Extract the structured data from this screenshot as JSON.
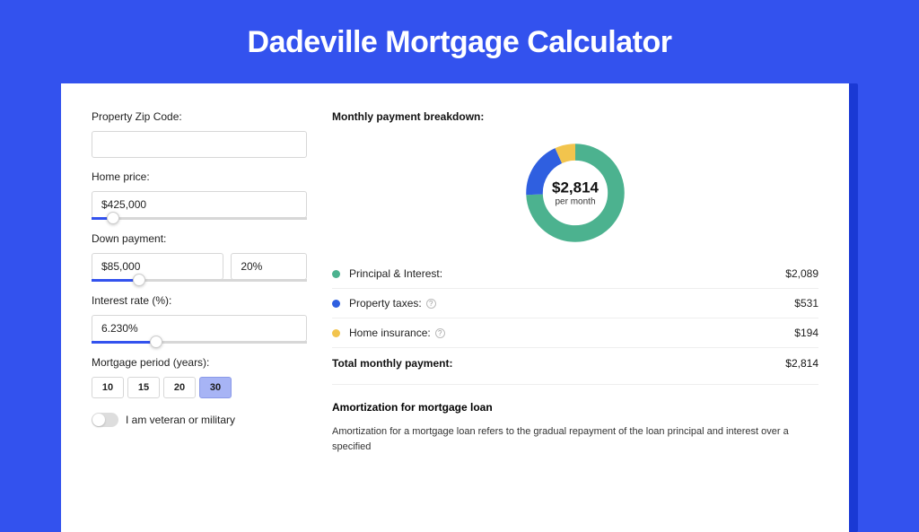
{
  "title": "Dadeville Mortgage Calculator",
  "form": {
    "zip": {
      "label": "Property Zip Code:",
      "value": ""
    },
    "home_price": {
      "label": "Home price:",
      "value": "$425,000",
      "slider_fill_pct": 10,
      "thumb_pct": 10
    },
    "down_payment": {
      "label": "Down payment:",
      "value": "$85,000",
      "pct_value": "20%",
      "slider_fill_pct": 22,
      "thumb_pct": 22
    },
    "interest": {
      "label": "Interest rate (%):",
      "value": "6.230%",
      "slider_fill_pct": 30,
      "thumb_pct": 30
    },
    "period": {
      "label": "Mortgage period (years):",
      "options": [
        "10",
        "15",
        "20",
        "30"
      ],
      "selected": "30"
    },
    "veteran": {
      "label": "I am veteran or military",
      "on": false
    }
  },
  "breakdown": {
    "title": "Monthly payment breakdown:",
    "center_value": "$2,814",
    "center_sub": "per month",
    "items": [
      {
        "key": "principal",
        "label": "Principal & Interest:",
        "value": "$2,089",
        "color": "#4cb28f",
        "has_info": false,
        "fraction": 0.742
      },
      {
        "key": "taxes",
        "label": "Property taxes:",
        "value": "$531",
        "color": "#2f5fe0",
        "has_info": true,
        "fraction": 0.189
      },
      {
        "key": "insurance",
        "label": "Home insurance:",
        "value": "$194",
        "color": "#f2c44d",
        "has_info": true,
        "fraction": 0.069
      }
    ],
    "total_label": "Total monthly payment:",
    "total_value": "$2,814"
  },
  "amortization": {
    "title": "Amortization for mortgage loan",
    "text": "Amortization for a mortgage loan refers to the gradual repayment of the loan principal and interest over a specified"
  },
  "chart_data": {
    "type": "pie",
    "title": "Monthly payment breakdown",
    "series": [
      {
        "name": "Principal & Interest",
        "value": 2089,
        "color": "#4cb28f"
      },
      {
        "name": "Property taxes",
        "value": 531,
        "color": "#2f5fe0"
      },
      {
        "name": "Home insurance",
        "value": 194,
        "color": "#f2c44d"
      }
    ],
    "total": 2814,
    "unit": "USD per month"
  }
}
